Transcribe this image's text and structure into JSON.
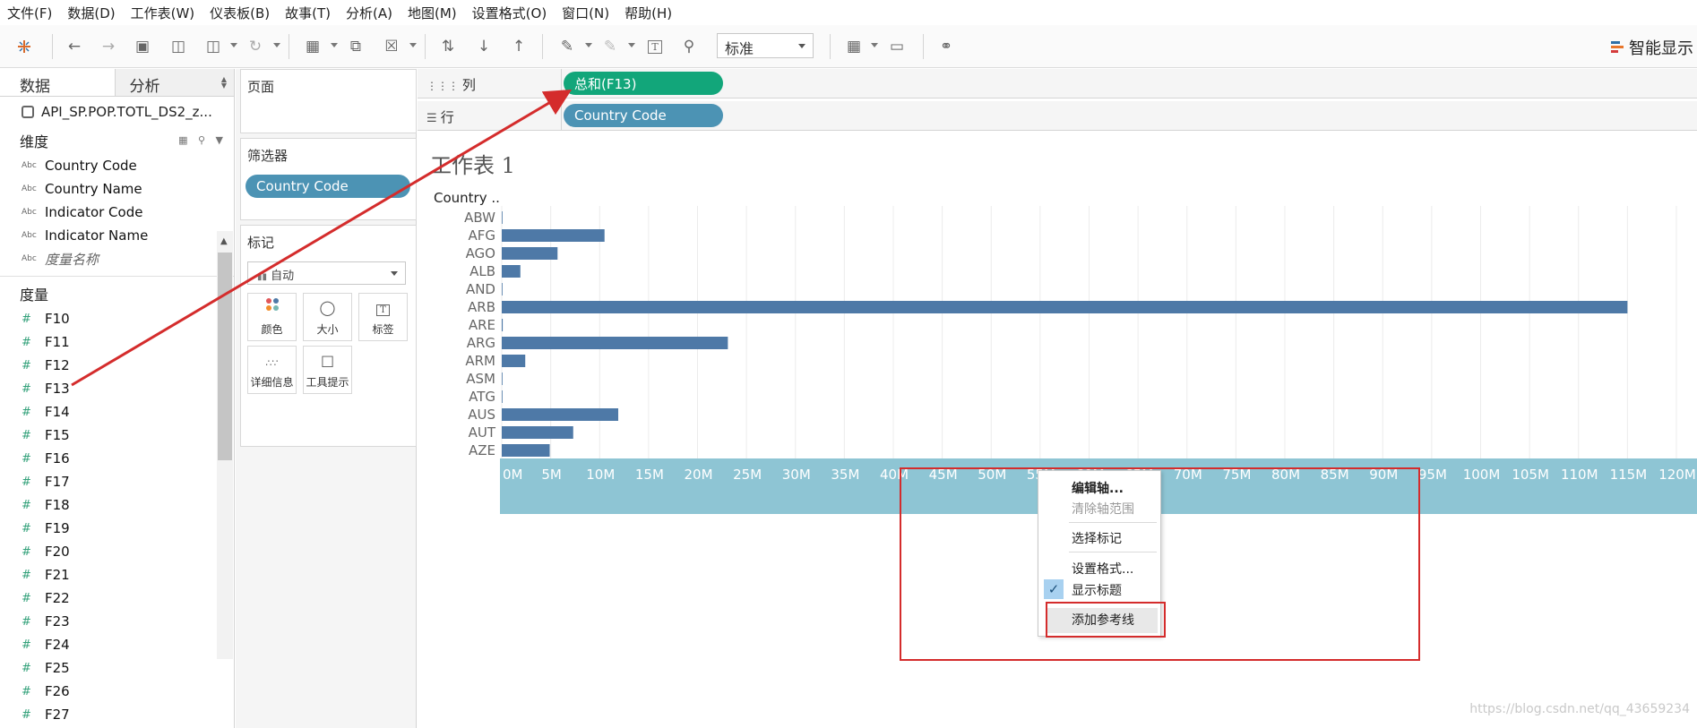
{
  "menu": [
    "文件(F)",
    "数据(D)",
    "工作表(W)",
    "仪表板(B)",
    "故事(T)",
    "分析(A)",
    "地图(M)",
    "设置格式(O)",
    "窗口(N)",
    "帮助(H)"
  ],
  "toolbar": {
    "standard_value": "标准",
    "smart_display": "智能显示"
  },
  "left_pane": {
    "tab_data": "数据",
    "tab_analysis": "分析",
    "datasource": "API_SP.POP.TOTL_DS2_z...",
    "dimensions_title": "维度",
    "dimensions": [
      "Country Code",
      "Country Name",
      "Indicator Code",
      "Indicator Name"
    ],
    "measure_names": "度量名称",
    "abc_tag": "Abc",
    "measures_title": "度量",
    "measures": [
      "F10",
      "F11",
      "F12",
      "F13",
      "F14",
      "F15",
      "F16",
      "F17",
      "F18",
      "F19",
      "F20",
      "F21",
      "F22",
      "F23",
      "F24",
      "F25",
      "F26",
      "F27"
    ]
  },
  "cards": {
    "pages_title": "页面",
    "filters_title": "筛选器",
    "filter_pill": "Country Code",
    "marks_title": "标记",
    "marks_type": "自动",
    "mark_buttons": [
      "颜色",
      "大小",
      "标签",
      "详细信息",
      "工具提示"
    ]
  },
  "shelves": {
    "columns_label": "列",
    "columns_pill": "总和(F13)",
    "rows_label": "行",
    "rows_pill": "Country Code"
  },
  "worksheet": {
    "title": "工作表 1",
    "row_header": "Country .."
  },
  "chart_data": {
    "type": "bar",
    "orientation": "horizontal",
    "categories": [
      "ABW",
      "AFG",
      "AGO",
      "ALB",
      "AND",
      "ARB",
      "ARE",
      "ARG",
      "ARM",
      "ASM",
      "ATG",
      "AUS",
      "AUT",
      "AZE"
    ],
    "values": [
      0.06,
      10.5,
      5.7,
      1.9,
      0.05,
      115.0,
      0.1,
      23.1,
      2.4,
      0.05,
      0.06,
      11.9,
      7.3,
      4.9
    ],
    "value_unit": "M",
    "xlim": [
      0,
      120
    ],
    "xticks": [
      "0M",
      "5M",
      "10M",
      "15M",
      "20M",
      "25M",
      "30M",
      "35M",
      "40M",
      "45M",
      "50M",
      "55M",
      "60M",
      "65M",
      "70M",
      "75M",
      "80M",
      "85M",
      "90M",
      "95M",
      "100M",
      "105M",
      "110M",
      "115M",
      "120M"
    ],
    "bar_color": "#4e79a7",
    "grid": "vertical"
  },
  "context_menu": {
    "items": [
      {
        "label": "编辑轴...",
        "state": "bold"
      },
      {
        "label": "清除轴范围",
        "state": "disabled"
      },
      {
        "label": "选择标记",
        "state": "normal"
      },
      {
        "label": "设置格式...",
        "state": "normal"
      },
      {
        "label": "显示标题",
        "state": "checked"
      },
      {
        "label": "添加参考线",
        "state": "hover"
      }
    ]
  },
  "watermark": "https://blog.csdn.net/qq_43659234",
  "colors": {
    "pill_blue": "#4c93b4",
    "pill_green": "#12a67a",
    "axis_band": "#8ec5d4",
    "annotation_red": "#d42c2c"
  }
}
